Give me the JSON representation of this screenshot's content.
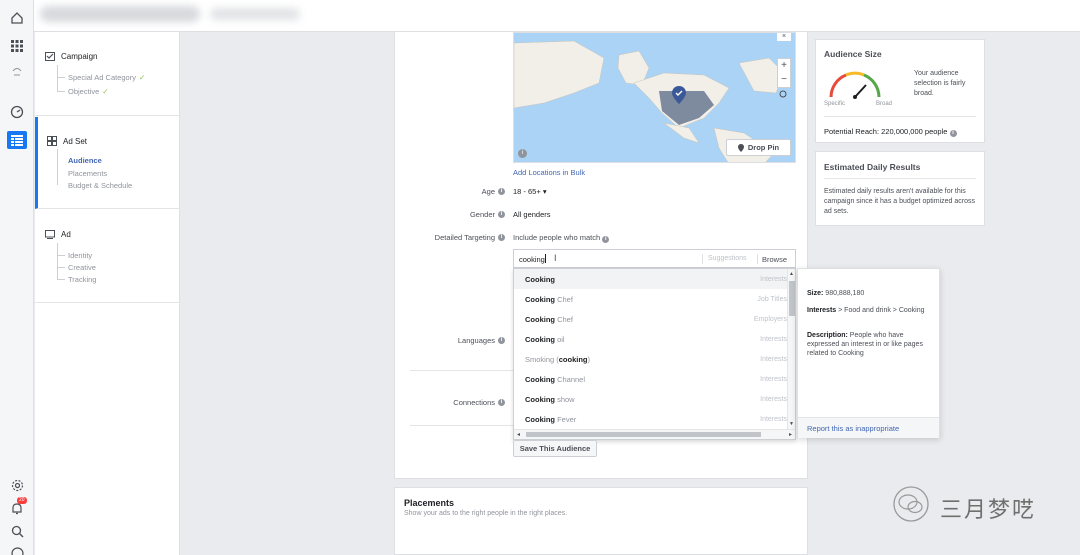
{
  "nav": {
    "campaign": {
      "title": "Campaign",
      "items": [
        "Special Ad Category",
        "Objective"
      ]
    },
    "adset": {
      "title": "Ad Set",
      "items": [
        "Audience",
        "Placements",
        "Budget & Schedule"
      ]
    },
    "ad": {
      "title": "Ad",
      "items": [
        "Identity",
        "Creative",
        "Tracking"
      ]
    }
  },
  "map": {
    "add_locations": "Add Locations in Bulk",
    "drop_pin": "Drop Pin"
  },
  "form": {
    "age_label": "Age",
    "age_value": "18 - 65+",
    "gender_label": "Gender",
    "gender_value": "All genders",
    "detailed_label": "Detailed Targeting",
    "include_text": "Include people who match",
    "languages_label": "Languages",
    "connections_label": "Connections",
    "save_audience": "Save This Audience"
  },
  "search": {
    "value": "cooking",
    "suggestions": "Suggestions",
    "browse": "Browse"
  },
  "results": [
    {
      "bold": "Cooking",
      "rest": "",
      "type": "Interests"
    },
    {
      "bold": "Cooking",
      "rest": " Chef",
      "type": "Job Titles"
    },
    {
      "bold": "Cooking",
      "rest": " Chef",
      "type": "Employers"
    },
    {
      "bold": "Cooking",
      "rest": " oil",
      "type": "Interests"
    },
    {
      "pre": "Smoking (",
      "bold": "cooking",
      "rest": ")",
      "type": "Interests"
    },
    {
      "bold": "Cooking",
      "rest": " Channel",
      "type": "Interests"
    },
    {
      "bold": "Cooking",
      "rest": " show",
      "type": "Interests"
    },
    {
      "bold": "Cooking",
      "rest": " Fever",
      "type": "Interests"
    }
  ],
  "tooltip": {
    "size_label": "Size:",
    "size_value": "980,888,180",
    "interests_label": "Interests",
    "interests_value": " > Food and drink > Cooking",
    "desc_label": "Description:",
    "desc_value": " People who have expressed an interest in or like pages related to Cooking",
    "report": "Report this as inappropriate"
  },
  "audience_size": {
    "title": "Audience Size",
    "specific": "Specific",
    "broad": "Broad",
    "note": "Your audience selection is fairly broad.",
    "reach": "Potential Reach: 220,000,000 people"
  },
  "daily": {
    "title": "Estimated Daily Results",
    "text": "Estimated daily results aren't available for this campaign since it has a budget optimized across ad sets."
  },
  "placements": {
    "title": "Placements",
    "subtitle": "Show your ads to the right people in the right places."
  },
  "watermark": "三月梦呓",
  "colors": {
    "accent": "#1877f2",
    "link": "#4267b2",
    "gauge_red": "#e84a3c",
    "gauge_green": "#57a64a"
  }
}
